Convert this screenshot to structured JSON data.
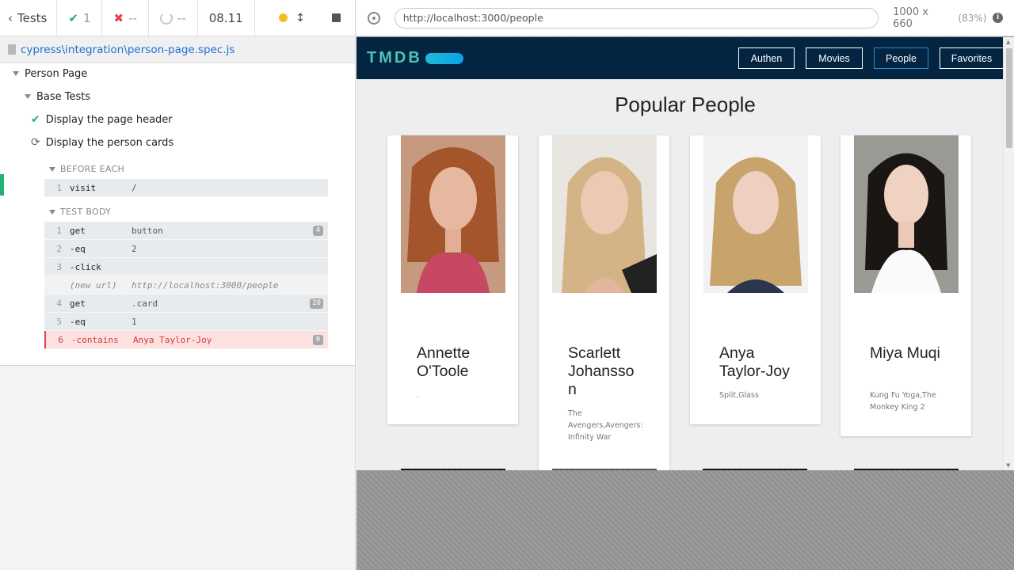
{
  "reporter": {
    "back_label": "Tests",
    "passed_count": "1",
    "failed_count": "--",
    "pending_count": "--",
    "duration": "08.11",
    "spec_path": "cypress\\integration\\person-page.spec.js",
    "suites": {
      "root": "Person Page",
      "child": "Base Tests"
    },
    "tests": [
      {
        "title": "Display the page header",
        "state": "passed"
      },
      {
        "title": "Display the person cards",
        "state": "running"
      }
    ],
    "before_each": {
      "title": "BEFORE EACH",
      "commands": [
        {
          "n": "1",
          "name": "visit",
          "arg": "/"
        }
      ]
    },
    "test_body": {
      "title": "TEST BODY",
      "commands": [
        {
          "n": "1",
          "name": "get",
          "arg": "button",
          "badge": "4"
        },
        {
          "n": "2",
          "name": "-eq",
          "arg": "2"
        },
        {
          "n": "3",
          "name": "-click",
          "arg": ""
        },
        {
          "n": "",
          "name": "(new url)",
          "arg": "http://localhost:3000/people"
        },
        {
          "n": "4",
          "name": "get",
          "arg": ".card",
          "badge": "20"
        },
        {
          "n": "5",
          "name": "-eq",
          "arg": "1"
        },
        {
          "n": "6",
          "name": "-contains",
          "arg": "Anya Taylor-Joy",
          "badge": "0"
        }
      ]
    }
  },
  "aut": {
    "url": "http://localhost:3000/people",
    "viewport": "1000 x 660",
    "scale": "(83%)",
    "app": {
      "logo": "TMDB",
      "nav": [
        "Authen",
        "Movies",
        "People",
        "Favorites"
      ],
      "active_nav": "People",
      "page_title": "Popular People",
      "cards": [
        {
          "name": "Annette O'Toole",
          "known_for": "."
        },
        {
          "name": "Scarlett Johansson",
          "known_for": "The Avengers,Avengers: Infinity War"
        },
        {
          "name": "Anya Taylor-Joy",
          "known_for": "Split,Glass"
        },
        {
          "name": "Miya Muqi",
          "known_for": "Kung Fu Yoga,The Monkey King 2"
        }
      ]
    }
  },
  "colors": {
    "pass": "#1fb277",
    "fail": "#e0454b",
    "link": "#1d6fd6",
    "navbar": "#032541",
    "logo_text": "#4fc3b8"
  },
  "icons": [
    "chevron-left-icon",
    "check-icon",
    "x-icon",
    "spinner-icon",
    "status-dot-icon",
    "resize-icon",
    "stop-icon",
    "file-icon",
    "crosshair-icon",
    "info-icon",
    "retry-icon"
  ]
}
